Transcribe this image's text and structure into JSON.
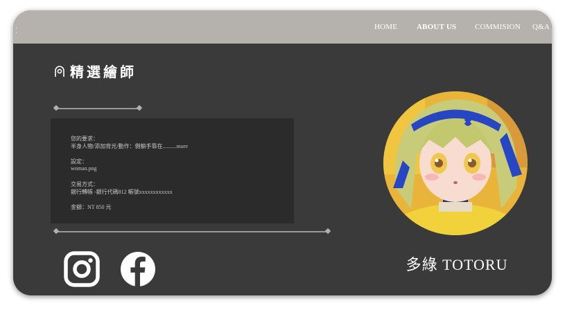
{
  "header": {
    "nav": [
      {
        "label": "HOME",
        "active": false
      },
      {
        "label": "ABOUT US",
        "active": true
      },
      {
        "label": "COMMISION",
        "active": false
      },
      {
        "label": "Q&A",
        "active": false
      }
    ]
  },
  "main": {
    "title": "精選繪師",
    "details": {
      "request_label": "您的要求：",
      "request_value": "半身人物/添加背光/動作：側躺手靠在..........more",
      "settings_label": "設定：",
      "settings_value": "woman.png",
      "payment_label": "交易方式：",
      "payment_value": "銀行轉帳 -銀行代碼812 帳號xxxxxxxxxxxx",
      "amount_label": "金額：NT 850 元"
    },
    "artist_name": "多綠 TOTORU"
  },
  "icons": {
    "location": "map-pin-icon",
    "instagram": "instagram-icon",
    "facebook": "facebook-icon"
  },
  "colors": {
    "topbar": "#b5b1ac",
    "background": "#3a3a3a",
    "panel": "#2b2b2b",
    "text": "#ffffff"
  }
}
